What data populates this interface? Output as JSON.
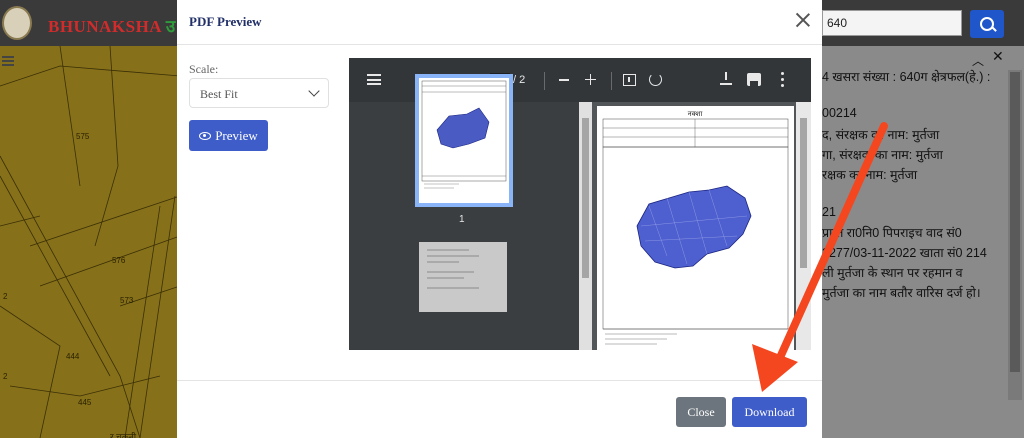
{
  "app": {
    "brand_red": "BHUNAKSHA",
    "brand_green": "उ",
    "search_value": "640",
    "map_labels": [
      "575",
      "576",
      "573",
      "444",
      "445",
      "2",
      "2"
    ],
    "bottom_fragment": "र चकनी"
  },
  "info_panel": {
    "lines": [
      "4 खसरा संख्या : 640ग क्षेत्रफल(हे.) :",
      "00214",
      "द, संरक्षक का नाम: मुर्तजा",
      "गा, संरक्षक का नाम: मुर्तजा",
      "रक्षक का नाम: मुर्तजा",
      "21",
      "प्राप्त रा0नि0 पिपराइच वाद सं0",
      "2277/03-11-2022 खाता सं0 214",
      "ली मुर्तजा के स्थान पर रहमान व",
      "मुर्तजा का नाम बतौर वारिस दर्ज हो।"
    ]
  },
  "modal": {
    "title": "PDF Preview",
    "scale_label": "Scale:",
    "scale_value": "Best Fit",
    "preview_label": "Preview",
    "close_label": "Close",
    "download_label": "Download"
  },
  "viewer": {
    "current_page": "1",
    "total_pages": "/ 2",
    "thumbnail_number": "1",
    "page_heading": "नक्शा"
  },
  "colors": {
    "accent": "#3f5dc9",
    "secondary_button": "#6c757d",
    "annotation_arrow": "#f4471f"
  }
}
